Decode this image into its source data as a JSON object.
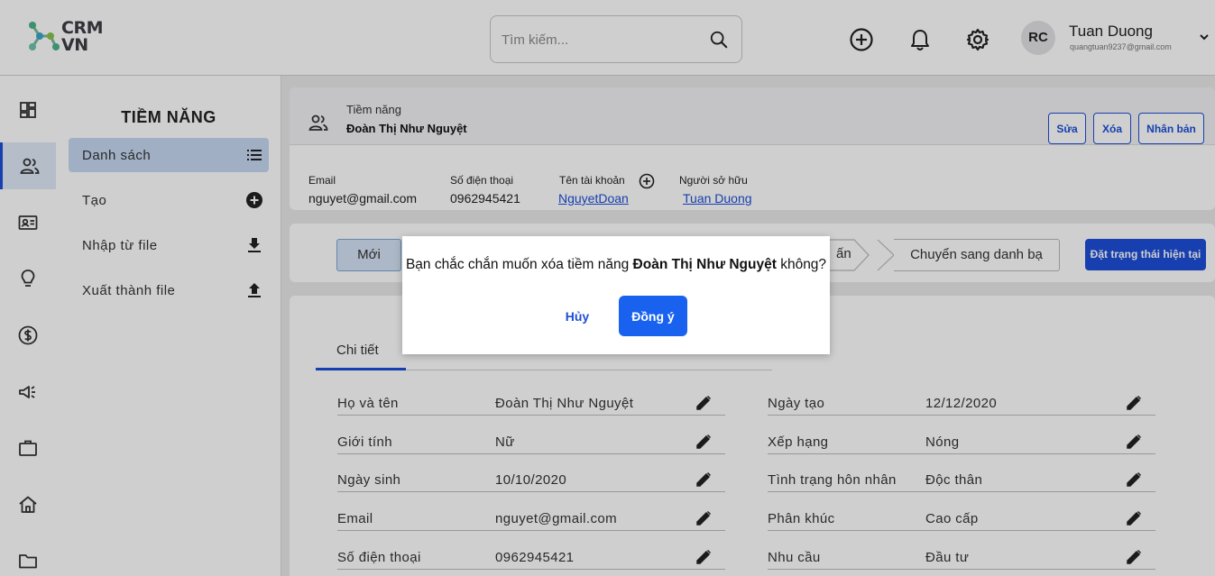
{
  "brand": {
    "line1": "CRM",
    "line2": "VN"
  },
  "search": {
    "placeholder": "Tìm kiếm..."
  },
  "user": {
    "initials": "RC",
    "name": "Tuan Duong",
    "email": "quangtuan9237@gmail.com"
  },
  "rail": {
    "items": [
      "dashboard",
      "leads",
      "contacts",
      "ideas",
      "deals",
      "campaigns",
      "cases",
      "home",
      "files"
    ]
  },
  "sidebar": {
    "title": "TIỀM NĂNG",
    "items": [
      {
        "label": "Danh sách",
        "icon": "list-icon"
      },
      {
        "label": "Tạo",
        "icon": "add-circle-icon"
      },
      {
        "label": "Nhập từ file",
        "icon": "download-icon"
      },
      {
        "label": "Xuất thành file",
        "icon": "upload-icon"
      }
    ]
  },
  "record": {
    "type": "Tiềm năng",
    "name": "Đoàn Thị Như Nguyệt",
    "actions": {
      "edit": "Sửa",
      "delete": "Xóa",
      "clone": "Nhân bản"
    },
    "info": {
      "email_label": "Email",
      "email": "nguyet@gmail.com",
      "phone_label": "Số điện thoại",
      "phone": "0962945421",
      "account_label": "Tên tài khoản",
      "account": "NguyetDoan",
      "owner_label": "Người sở hữu",
      "owner": "Tuan Duong"
    }
  },
  "status": {
    "steps": {
      "first": "Mới",
      "partial": "ấn",
      "last": "Chuyển sang danh bạ"
    },
    "set_button": "Đặt trạng thái hiện tại"
  },
  "details": {
    "tab": "Chi tiết",
    "left": [
      {
        "label": "Họ và tên",
        "value": "Đoàn Thị Như Nguyệt"
      },
      {
        "label": "Giới tính",
        "value": "Nữ"
      },
      {
        "label": "Ngày sinh",
        "value": "10/10/2020"
      },
      {
        "label": "Email",
        "value": "nguyet@gmail.com"
      },
      {
        "label": "Số điện thoại",
        "value": "0962945421"
      }
    ],
    "right": [
      {
        "label": "Ngày tạo",
        "value": "12/12/2020"
      },
      {
        "label": "Xếp hạng",
        "value": "Nóng"
      },
      {
        "label": "Tình trạng hôn nhân",
        "value": "Độc thân"
      },
      {
        "label": "Phân khúc",
        "value": "Cao cấp"
      },
      {
        "label": "Nhu cầu",
        "value": "Đầu tư"
      }
    ]
  },
  "dialog": {
    "msg_prefix": "Bạn chắc chắn muốn xóa tiềm năng ",
    "msg_name": "Đoàn Thị Như Nguyệt",
    "msg_suffix": " không?",
    "cancel": "Hủy",
    "confirm": "Đồng ý"
  },
  "colors": {
    "primary": "#1d4ed8",
    "confirm": "#1962f0",
    "active_bg": "#c5d8f2"
  }
}
